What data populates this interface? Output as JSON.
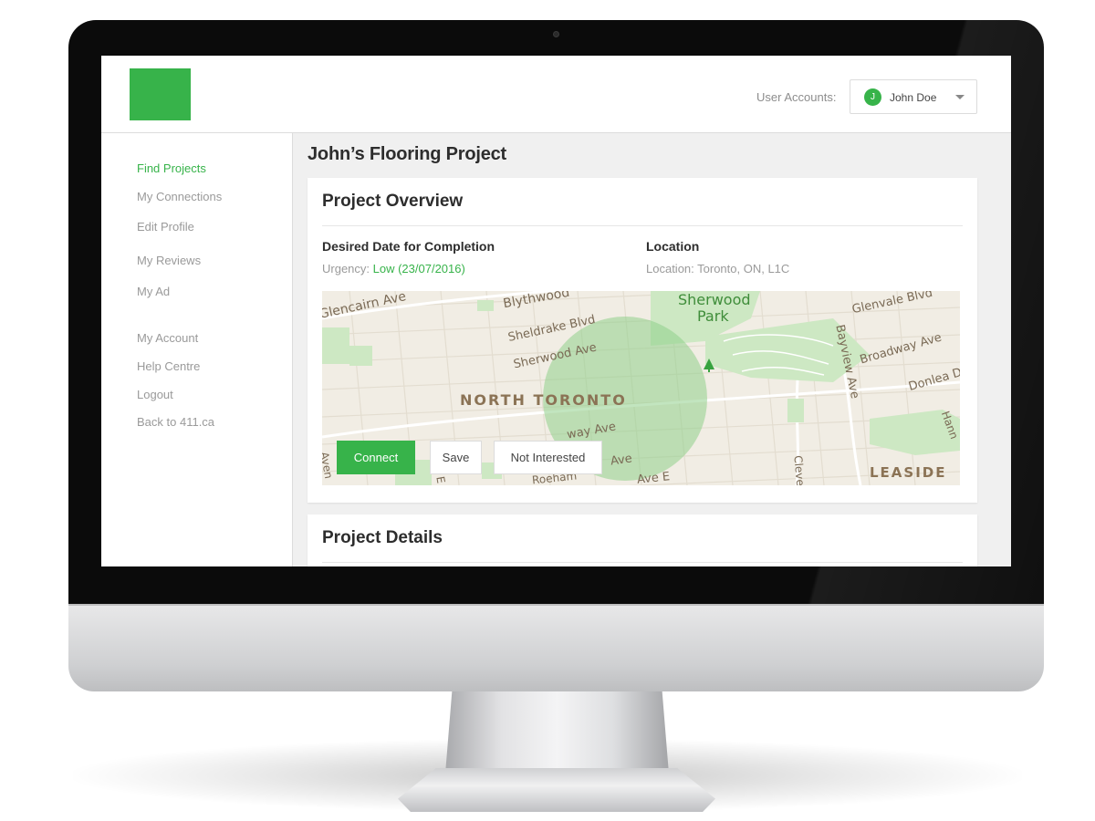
{
  "header": {
    "user_accounts_label": "User Accounts:",
    "account": {
      "avatar_initial": "J",
      "name": "John Doe"
    }
  },
  "sidebar": {
    "items": [
      {
        "label": "Find Projects",
        "active": true
      },
      {
        "label": "My Connections"
      },
      {
        "label": "Edit Profile"
      },
      {
        "label": "My Reviews"
      },
      {
        "label": "My Ad"
      },
      {
        "label": "My Account"
      },
      {
        "label": "Help Centre"
      },
      {
        "label": "Logout"
      },
      {
        "label": "Back to 411.ca"
      }
    ]
  },
  "page": {
    "title": "John’s Flooring Project"
  },
  "overview": {
    "title": "Project Overview",
    "completion": {
      "label": "Desired Date for Completion",
      "urgency_prefix": "Urgency: ",
      "urgency_value": "Low (23/07/2016)"
    },
    "location": {
      "label": "Location",
      "value": "Location: Toronto, ON, L1C"
    },
    "map": {
      "labels": {
        "glencairn": "Glencairn Ave",
        "blythwood": "Blythwood",
        "sheldrake": "Sheldrake Blvd",
        "sherwood_ave": "Sherwood Ave",
        "sherwood_park_1": "Sherwood",
        "sherwood_park_2": "Park",
        "glenvale": "Glenvale Blvd",
        "bayview": "Bayview Ave",
        "broadway": "Broadway Ave",
        "donlea": "Donlea D",
        "hanna": "Hann",
        "north_toronto": "NORTH TORONTO",
        "leaside": "LEASIDE",
        "cleve": "Cleve",
        "eglinton_e": "Ave E",
        "roehampton": "Roeham",
        "way_ave": "way Ave",
        "ave_bottom": "Ave",
        "aven": "Aven",
        "e_fragment": "E"
      }
    },
    "actions": {
      "connect": "Connect",
      "save": "Save",
      "not_interested": "Not Interested"
    }
  },
  "details": {
    "title": "Project Details"
  },
  "colors": {
    "accent": "#37b34a",
    "text_primary": "#2d2d2d",
    "text_muted": "#9a9a9a"
  }
}
